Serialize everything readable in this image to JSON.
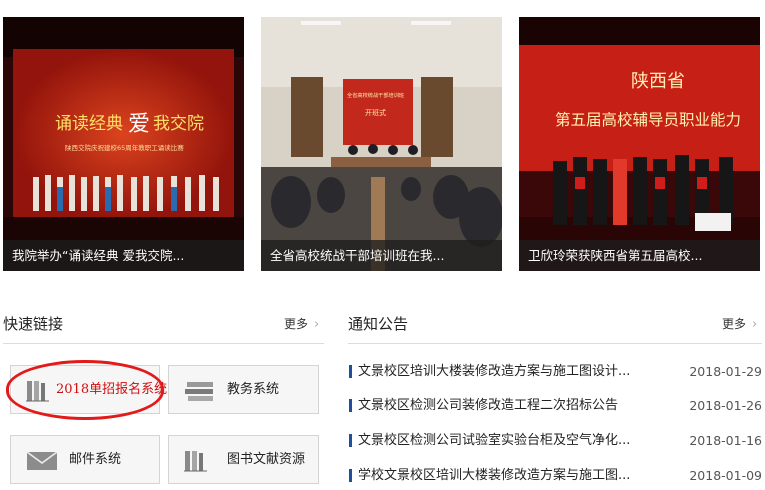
{
  "news": [
    {
      "caption": "我院举办“诵读经典 爱我交院..."
    },
    {
      "caption": "全省高校统战干部培训班在我..."
    },
    {
      "caption": "卫欣玲荣获陕西省第五届高校..."
    }
  ],
  "photo_text": {
    "stage1_title_a": "诵读经典",
    "stage1_title_heart": "爱",
    "stage1_title_b": "我交院",
    "stage1_subtitle": "陕西交院庆祝建校65周年教职工诵读比赛",
    "stage2_screen_a": "全省高校统战干部培训班",
    "stage2_screen_b": "开班式",
    "stage3_banner_a": "陕西省",
    "stage3_banner_b": "第五届高校辅导员职业能力"
  },
  "quick_links": {
    "title": "快速链接",
    "more": "更多",
    "items": [
      {
        "label": "2018单招报名系统",
        "icon": "books-icon"
      },
      {
        "label": "教务系统",
        "icon": "books-stack-icon"
      },
      {
        "label": "邮件系统",
        "icon": "mail-icon"
      },
      {
        "label": "图书文献资源",
        "icon": "books-icon"
      }
    ]
  },
  "notices": {
    "title": "通知公告",
    "more": "更多",
    "items": [
      {
        "text": "文景校区培训大楼装修改造方案与施工图设计...",
        "date": "2018-01-29"
      },
      {
        "text": "文景校区检测公司装修改造工程二次招标公告",
        "date": "2018-01-26"
      },
      {
        "text": "文景校区检测公司试验室实验台柜及空气净化...",
        "date": "2018-01-16"
      },
      {
        "text": "学校文景校区培训大楼装修改造方案与施工图...",
        "date": "2018-01-09"
      }
    ]
  },
  "colors": {
    "highlight_red": "#e11a1a",
    "notice_bar": "#1f4e9c"
  }
}
